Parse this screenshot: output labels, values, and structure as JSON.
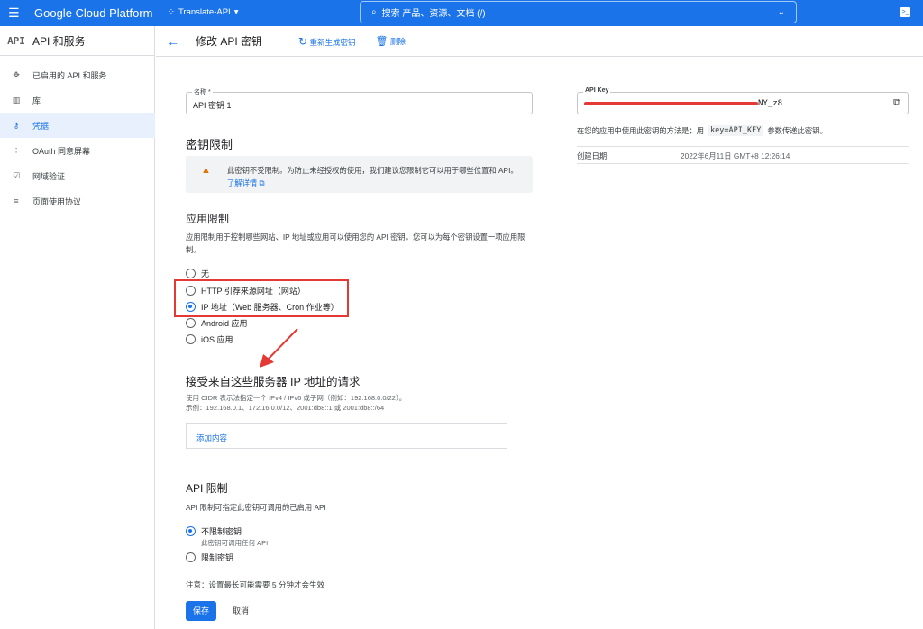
{
  "header": {
    "brand": "Google Cloud Platform",
    "project": "Translate-API",
    "search_placeholder": "搜索  产品、资源、文档 (/)"
  },
  "sidebar": {
    "title": "API 和服务",
    "logo": "API",
    "items": [
      {
        "label": "已启用的 API 和服务",
        "icon": "hub-icon"
      },
      {
        "label": "库",
        "icon": "library-icon"
      },
      {
        "label": "凭据",
        "icon": "key-icon",
        "active": true
      },
      {
        "label": "OAuth 同意屏幕",
        "icon": "consent-icon"
      },
      {
        "label": "网域验证",
        "icon": "checkbox-icon"
      },
      {
        "label": "页面使用协议",
        "icon": "settings-list-icon"
      }
    ]
  },
  "toolbar": {
    "title": "修改 API 密钥",
    "regenerate": "重新生成密钥",
    "delete": "删除"
  },
  "form": {
    "name_label": "名称 *",
    "name_value": "API 密钥 1",
    "key_restrictions_title": "密钥限制",
    "warning_text": "此密钥不受限制。为防止未经授权的使用，我们建议您限制它可以用于哪些位置和 API。",
    "learn_more": "了解详情",
    "app_restrictions_title": "应用限制",
    "app_restrictions_desc": "应用限制用于控制哪些网站、IP 地址或应用可以使用您的 API 密钥。您可以为每个密钥设置一项应用限制。",
    "app_options": [
      "无",
      "HTTP 引荐来源网址（网站）",
      "IP 地址（Web 服务器、Cron 作业等）",
      "Android 应用",
      "iOS 应用"
    ],
    "app_selected": 2,
    "ip_title": "接受来自这些服务器 IP 地址的请求",
    "ip_hint1": "使用 CIDR 表示法指定一个 IPv4 / IPv6 或子网（例如：192.168.0.0/22）。",
    "ip_hint2": "示例：192.168.0.1、172.16.0.0/12、2001:db8::1 或 2001:db8::/64",
    "ip_add": "添加内容",
    "api_restrictions_title": "API 限制",
    "api_restrictions_desc": "API 限制可指定此密钥可调用的已启用 API",
    "api_options": [
      "不限制密钥",
      "限制密钥"
    ],
    "api_option_sub": "此密钥可调用任何 API",
    "note": "注意：设置最长可能需要 5 分钟才会生效",
    "save": "保存",
    "cancel": "取消"
  },
  "key_panel": {
    "label": "API Key",
    "value_visible": "NY_z8",
    "usage_pre": "在您的应用中使用此密钥的方法是：用",
    "usage_code": "key=API_KEY",
    "usage_post": "参数传递此密钥。",
    "created_label": "创建日期",
    "created_value": "2022年6月11日 GMT+8 12:26:14"
  },
  "colors": {
    "primary": "#1a73e8",
    "annotation": "#e53935",
    "warning": "#e37400"
  }
}
